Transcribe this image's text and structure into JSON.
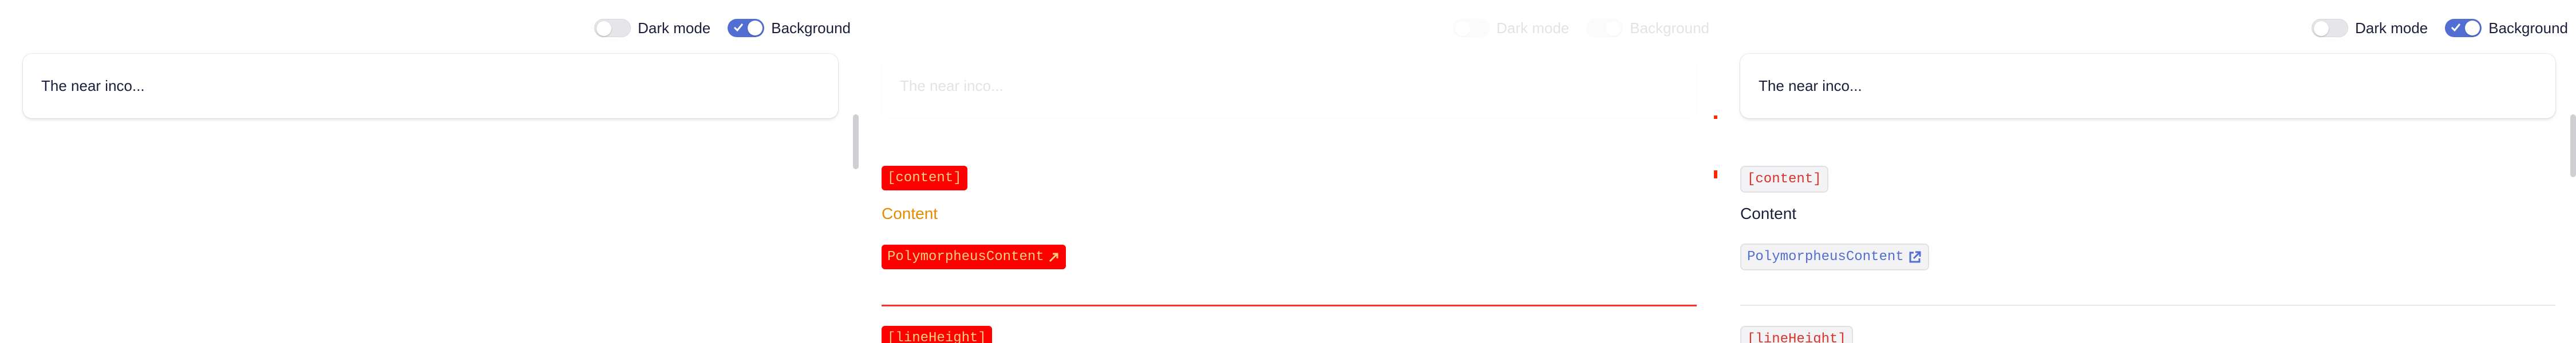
{
  "toggles": {
    "dark_mode_label": "Dark mode",
    "background_label": "Background"
  },
  "textfield": {
    "value": "The near inco..."
  },
  "docs": {
    "content_tag": "[content]",
    "content_text": "Content",
    "polymorpheus_link": "PolymorpheusContent",
    "line_height_tag": "[lineHeight]"
  },
  "diff": {
    "content_tag": "[content]",
    "content_text": "Content",
    "polymorpheus_link": "PolymorpheusContent",
    "line_height_tag": "[lineHeight]"
  },
  "colors": {
    "accent": "#526ed3",
    "code_text": "#d9332e",
    "diff_red": "#ff0000",
    "diff_text": "#ffcf7a"
  }
}
